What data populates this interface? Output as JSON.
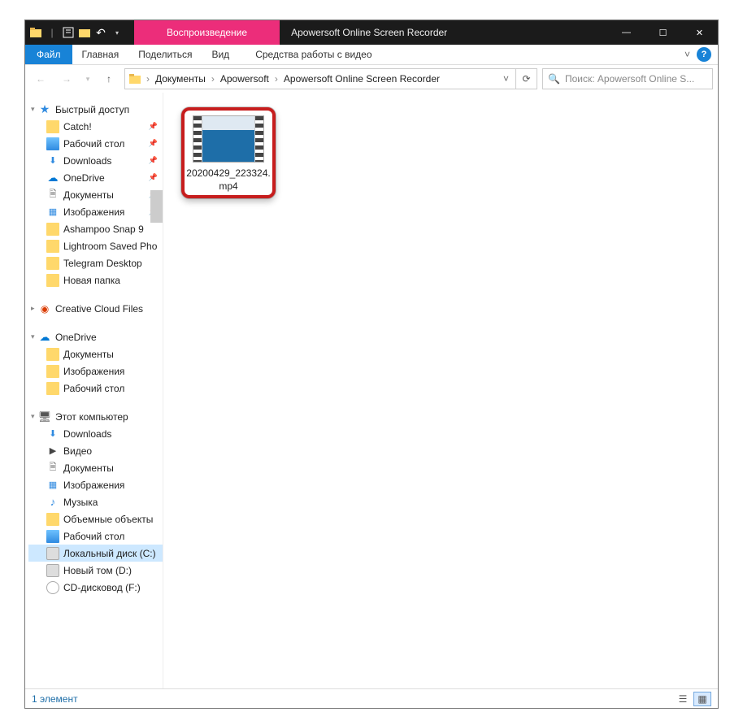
{
  "titlebar": {
    "contextual_tab_label": "Воспроизведение",
    "window_title": "Apowersoft Online Screen Recorder"
  },
  "ribbon": {
    "tabs": {
      "file": "Файл",
      "home": "Главная",
      "share": "Поделиться",
      "view": "Вид",
      "ctx": "Средства работы с видео"
    }
  },
  "address": {
    "crumbs": [
      "Документы",
      "Apowersoft",
      "Apowersoft Online Screen Recorder"
    ]
  },
  "search": {
    "placeholder": "Поиск: Apowersoft Online S..."
  },
  "navpane": {
    "quick_access": {
      "label": "Быстрый доступ",
      "items": [
        {
          "label": "Catch!",
          "icon": "folder",
          "pinned": true
        },
        {
          "label": "Рабочий стол",
          "icon": "desktop",
          "pinned": true
        },
        {
          "label": "Downloads",
          "icon": "down",
          "pinned": true
        },
        {
          "label": "OneDrive",
          "icon": "onedrive",
          "pinned": true
        },
        {
          "label": "Документы",
          "icon": "docs",
          "pinned": true
        },
        {
          "label": "Изображения",
          "icon": "img",
          "pinned": true
        },
        {
          "label": "Ashampoo Snap 9",
          "icon": "folder",
          "pinned": false
        },
        {
          "label": "Lightroom Saved Pho",
          "icon": "folder",
          "pinned": false
        },
        {
          "label": "Telegram Desktop",
          "icon": "folder",
          "pinned": false
        },
        {
          "label": "Новая папка",
          "icon": "folder",
          "pinned": false
        }
      ]
    },
    "cc": {
      "label": "Creative Cloud Files"
    },
    "onedrive": {
      "label": "OneDrive",
      "items": [
        {
          "label": "Документы",
          "icon": "folder"
        },
        {
          "label": "Изображения",
          "icon": "folder"
        },
        {
          "label": "Рабочий стол",
          "icon": "folder"
        }
      ]
    },
    "this_pc": {
      "label": "Этот компьютер",
      "items": [
        {
          "label": "Downloads",
          "icon": "down"
        },
        {
          "label": "Видео",
          "icon": "vid"
        },
        {
          "label": "Документы",
          "icon": "docs"
        },
        {
          "label": "Изображения",
          "icon": "img"
        },
        {
          "label": "Музыка",
          "icon": "music"
        },
        {
          "label": "Объемные объекты",
          "icon": "folder"
        },
        {
          "label": "Рабочий стол",
          "icon": "desktop"
        },
        {
          "label": "Локальный диск (C:)",
          "icon": "disk",
          "selected": true
        },
        {
          "label": "Новый том (D:)",
          "icon": "disk"
        },
        {
          "label": "CD-дисковод (F:)",
          "icon": "cd"
        }
      ]
    }
  },
  "content": {
    "file": {
      "name_line1": "20200429_223324.",
      "name_line2": "mp4"
    }
  },
  "statusbar": {
    "count_text": "1 элемент"
  }
}
